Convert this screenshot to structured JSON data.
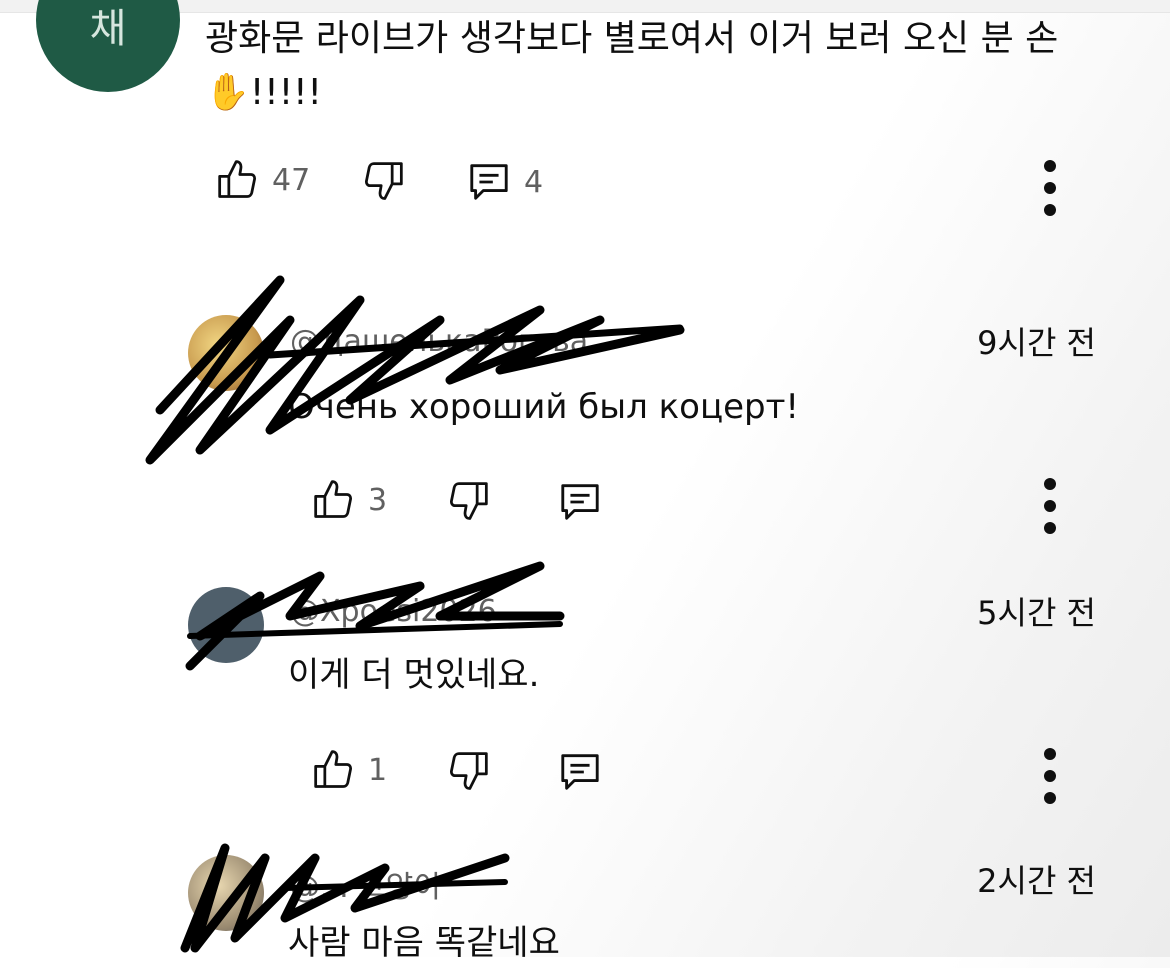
{
  "main_comment": {
    "avatar_letter": "채",
    "text": "광화문 라이브가 생각보다 별로여서 이거 보러 오신 분 손 ✋!!!!!",
    "like_count": "47",
    "reply_count": "4"
  },
  "replies": [
    {
      "handle": "@ДашенькаРоговa",
      "time": "9시간 전",
      "text": "Очень хороший был коцерт!",
      "like_count": "3"
    },
    {
      "handle": "@Xpoesi2026",
      "time": "5시간 전",
      "text": "이게 더 멋있네요.",
      "like_count": "1"
    },
    {
      "handle": "@... 고양이",
      "time": "2시간 전",
      "text": "사람 마음 똑같네요"
    }
  ],
  "icons": {
    "like": "thumbs-up-icon",
    "dislike": "thumbs-down-icon",
    "reply": "comment-icon",
    "more": "more-vert-icon"
  }
}
